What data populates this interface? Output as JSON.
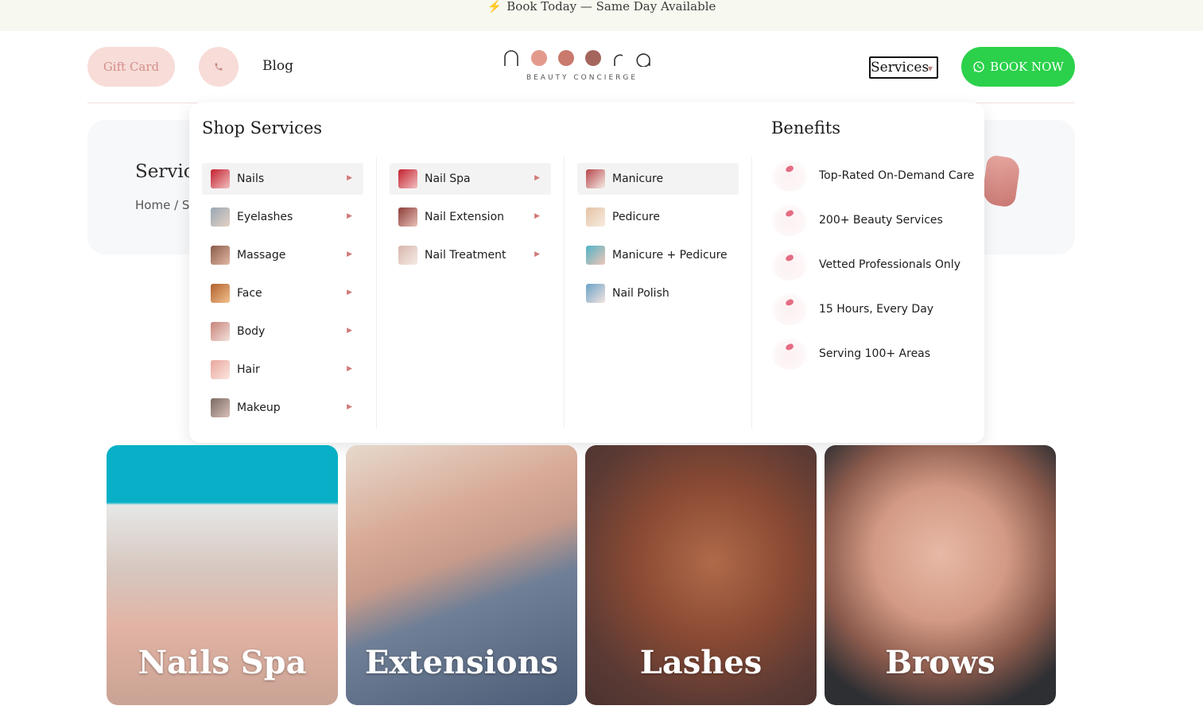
{
  "topbar": {
    "icon": "lightning-icon",
    "text": "Book Today — Same Day Available"
  },
  "header": {
    "gift_card": "Gift Card",
    "phone_icon": "phone-icon",
    "blog": "Blog",
    "logo": {
      "subtitle": "BEAUTY CONCIERGE",
      "dot_colors": [
        "#e39a8c",
        "#c97a6c",
        "#a4665c"
      ]
    },
    "services_select": "Services",
    "book_now": "BOOK NOW",
    "book_icon": "whatsapp-icon"
  },
  "hero": {
    "title": "Services",
    "breadcrumb": "Home / Services"
  },
  "mega_menu": {
    "shop_title": "Shop Services",
    "benefits_title": "Benefits",
    "categories": [
      {
        "label": "Nails",
        "active": true
      },
      {
        "label": "Eyelashes",
        "active": false
      },
      {
        "label": "Massage",
        "active": false
      },
      {
        "label": "Face",
        "active": false
      },
      {
        "label": "Body",
        "active": false
      },
      {
        "label": "Hair",
        "active": false
      },
      {
        "label": "Makeup",
        "active": false
      }
    ],
    "subcategories": [
      {
        "label": "Nail Spa",
        "active": true
      },
      {
        "label": "Nail Extension",
        "active": false
      },
      {
        "label": "Nail Treatment",
        "active": false
      }
    ],
    "services": [
      {
        "label": "Manicure",
        "active": true
      },
      {
        "label": "Pedicure",
        "active": false
      },
      {
        "label": "Manicure + Pedicure",
        "active": false
      },
      {
        "label": "Nail Polish",
        "active": false
      }
    ],
    "benefits": [
      "Top-Rated On-Demand Care",
      "200+ Beauty Services",
      "Vetted Professionals Only",
      "15 Hours, Every Day",
      "Serving 100+ Areas"
    ]
  },
  "tiles": [
    {
      "label": "Nails Spa"
    },
    {
      "label": "Extensions"
    },
    {
      "label": "Lashes"
    },
    {
      "label": "Brows"
    }
  ],
  "colors": {
    "accent_pink": "#f7dcd8",
    "book_green": "#2bd14b",
    "topbar_bg": "#f7f8ef"
  }
}
